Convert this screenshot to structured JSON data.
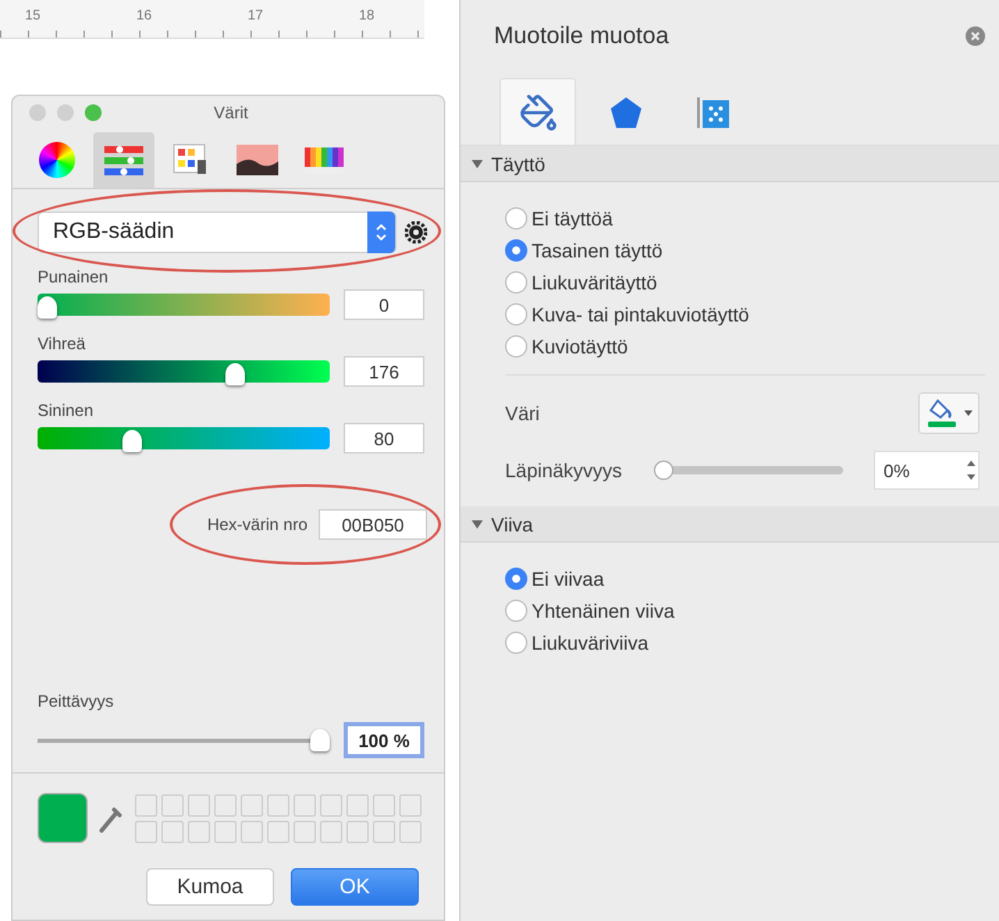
{
  "ruler": {
    "labels": [
      "15",
      "16",
      "17",
      "18"
    ]
  },
  "color_dialog": {
    "title": "Värit",
    "modes": [
      {
        "kind": "wheel",
        "selected": false
      },
      {
        "kind": "sliders",
        "selected": true
      },
      {
        "kind": "palettes",
        "selected": false
      },
      {
        "kind": "image",
        "selected": false
      },
      {
        "kind": "crayons",
        "selected": false
      }
    ],
    "slider_type": {
      "value": "RGB-säädin",
      "highlighted": true
    },
    "channels": [
      {
        "kind": "red",
        "name": "Punainen",
        "level": 0,
        "value": "0"
      },
      {
        "kind": "green",
        "name": "Vihreä",
        "level": 0.69,
        "value": "176"
      },
      {
        "kind": "blue",
        "name": "Sininen",
        "level": 0.31,
        "value": "80"
      }
    ],
    "hex": {
      "label": "Hex-värin nro",
      "value": "00B050",
      "highlighted": true
    },
    "opacity": {
      "label": "Peittävyys",
      "level": 1,
      "value": "100 %"
    },
    "buttons": [
      {
        "kind": "cancel",
        "label": "Kumoa"
      },
      {
        "kind": "default",
        "label": "OK"
      }
    ]
  },
  "format_panel": {
    "title": "Muotoile muotoa",
    "tabs": [
      {
        "kind": "fill",
        "selected": true
      },
      {
        "kind": "effects",
        "selected": false
      },
      {
        "kind": "size",
        "selected": false
      }
    ],
    "fill": {
      "title": "Täyttö",
      "expanded": true,
      "options": [
        {
          "label": "Ei täyttöä",
          "selected": false
        },
        {
          "label": "Tasainen täyttö",
          "selected": true
        },
        {
          "label": "Liukuväritäyttö",
          "selected": false
        },
        {
          "label": "Kuva- tai pintakuviotäyttö",
          "selected": false
        },
        {
          "label": "Kuviotäyttö",
          "selected": false
        }
      ],
      "color_label": "Väri",
      "transparency": {
        "label": "Läpinäkyvyys",
        "level": 0,
        "value": "0%"
      }
    },
    "line": {
      "title": "Viiva",
      "expanded": true,
      "options": [
        {
          "label": "Ei viivaa",
          "selected": true
        },
        {
          "label": "Yhtenäinen viiva",
          "selected": false
        },
        {
          "label": "Liukuväriviiva",
          "selected": false
        }
      ]
    }
  }
}
